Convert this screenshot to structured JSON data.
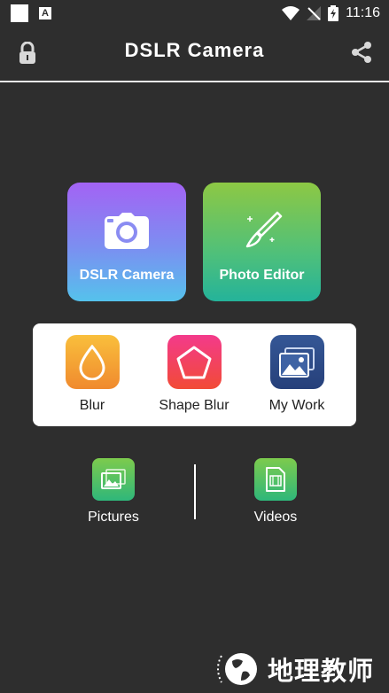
{
  "status_bar": {
    "time": "11:16"
  },
  "app_bar": {
    "title": "DSLR Camera"
  },
  "main_cards": [
    {
      "label": "DSLR Camera",
      "icon": "camera-icon"
    },
    {
      "label": "Photo Editor",
      "icon": "paintbrush-icon"
    }
  ],
  "tools": [
    {
      "label": "Blur",
      "icon": "drop-icon",
      "color": "#f39a2f"
    },
    {
      "label": "Shape Blur",
      "icon": "pentagon-icon",
      "color": "#f2307a"
    },
    {
      "label": "My Work",
      "icon": "gallery-icon",
      "color": "#2f4a8a"
    }
  ],
  "media": [
    {
      "label": "Pictures",
      "icon": "picture-icon"
    },
    {
      "label": "Videos",
      "icon": "video-file-icon"
    }
  ],
  "watermark": {
    "text": "地理教师"
  }
}
